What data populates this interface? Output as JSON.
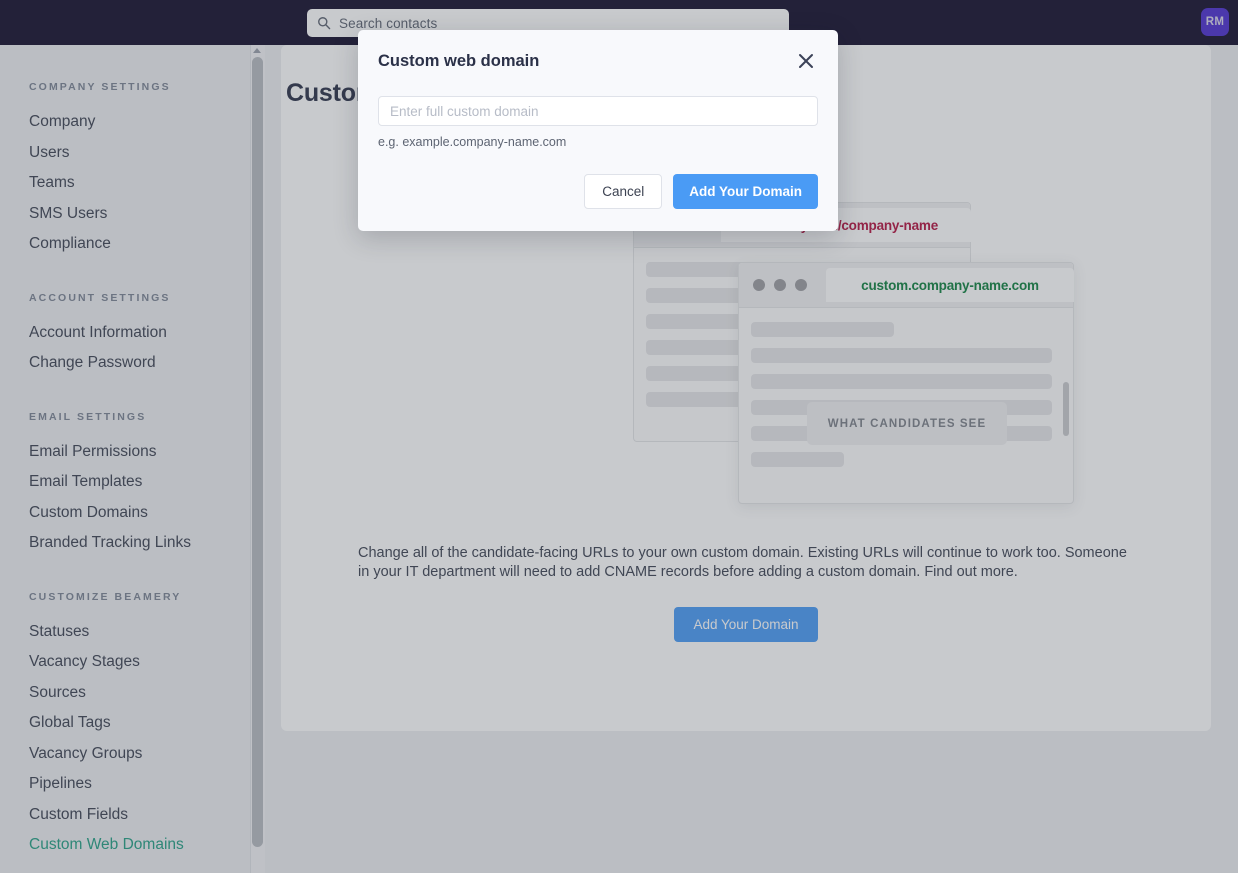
{
  "topbar": {
    "search": {
      "placeholder": "Search contacts",
      "icon": "search-icon"
    },
    "avatar_initials": "RM",
    "background_color": "#140d2c",
    "avatar_color": "#4c2fd0"
  },
  "sidebar": {
    "groups": [
      {
        "title": "COMPANY SETTINGS",
        "items": [
          {
            "label": "Company",
            "active": false
          },
          {
            "label": "Users",
            "active": false
          },
          {
            "label": "Teams",
            "active": false
          },
          {
            "label": "SMS Users",
            "active": false
          },
          {
            "label": "Compliance",
            "active": false
          }
        ]
      },
      {
        "title": "ACCOUNT SETTINGS",
        "items": [
          {
            "label": "Account Information",
            "active": false
          },
          {
            "label": "Change Password",
            "active": false
          }
        ]
      },
      {
        "title": "EMAIL SETTINGS",
        "items": [
          {
            "label": "Email Permissions",
            "active": false
          },
          {
            "label": "Email Templates",
            "active": false
          },
          {
            "label": "Custom Domains",
            "active": false
          },
          {
            "label": "Branded Tracking Links",
            "active": false
          }
        ]
      },
      {
        "title": "CUSTOMIZE BEAMERY",
        "items": [
          {
            "label": "Statuses",
            "active": false
          },
          {
            "label": "Vacancy Stages",
            "active": false
          },
          {
            "label": "Sources",
            "active": false
          },
          {
            "label": "Global Tags",
            "active": false
          },
          {
            "label": "Vacancy Groups",
            "active": false
          },
          {
            "label": "Pipelines",
            "active": false
          },
          {
            "label": "Custom Fields",
            "active": false
          },
          {
            "label": "Custom Web Domains",
            "active": true
          }
        ]
      }
    ],
    "active_color": "#24a085"
  },
  "main": {
    "page_title": "Custom Web Domains",
    "illustration": {
      "back_window": {
        "url": "beamery.com/company-name",
        "url_color": "#b4123f"
      },
      "front_window": {
        "url": "custom.company-name.com",
        "url_color": "#118240",
        "badge_label": "WHAT CANDIDATES SEE"
      }
    },
    "description": "Change all of the candidate-facing URLs to your own custom domain. Existing URLs will continue to work too. Someone in your IT department will need to add CNAME records before adding a custom domain. Find out more.",
    "cta_label": "Add Your Domain",
    "cta_color": "#4a9bf5"
  },
  "modal": {
    "title": "Custom web domain",
    "close_icon": "close-icon",
    "input": {
      "value": "",
      "placeholder": "Enter full custom domain"
    },
    "hint": "e.g. example.company-name.com",
    "cancel_label": "Cancel",
    "submit_label": "Add Your Domain",
    "submit_color": "#4a9bf5",
    "background_color": "#f8f9fc"
  }
}
